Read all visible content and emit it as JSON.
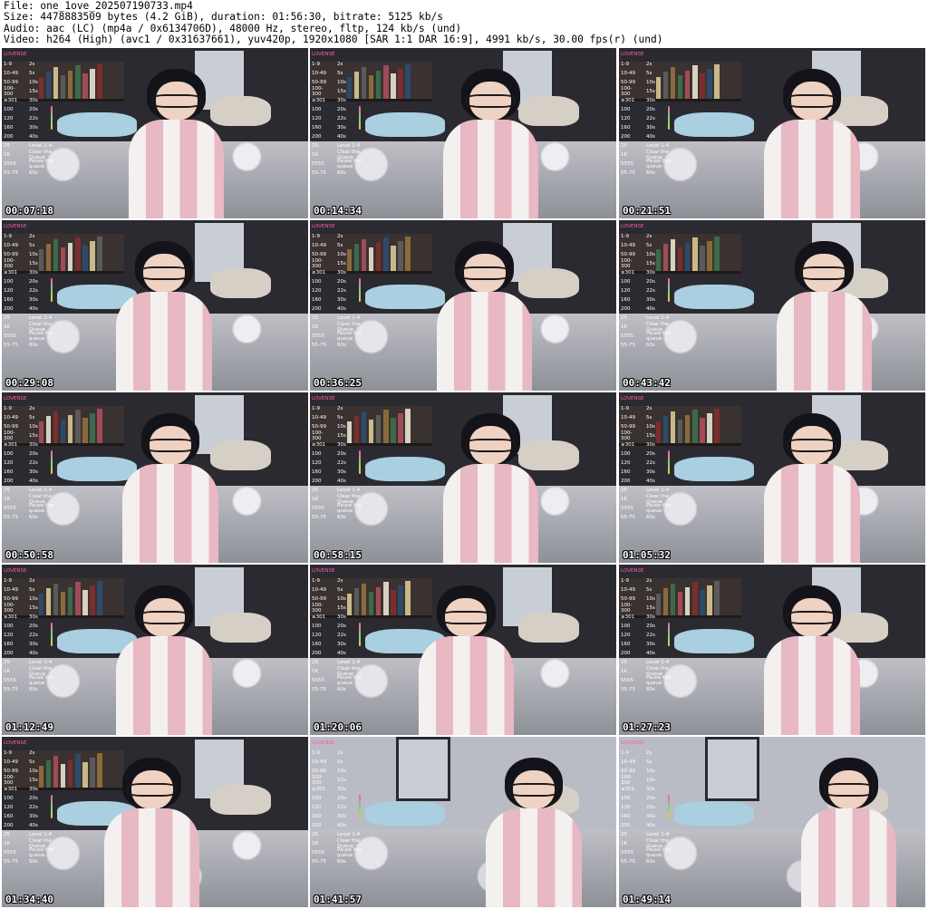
{
  "header": {
    "file": "File: one_1ove_202507190733.mp4",
    "size": "Size: 4478883509 bytes (4.2 GiB), duration: 01:56:30, bitrate: 5125 kb/s",
    "audio": "Audio: aac (LC) (mp4a / 0x6134706D), 48000 Hz, stereo, fltp, 124 kb/s (und)",
    "video": "Video: h264 (High) (avc1 / 0x31637661), yuv420p, 1920x1080 [SAR 1:1 DAR 16:9], 4991 kb/s, 30.00 fps(r) (und)"
  },
  "overlay": {
    "brand": "LOVENSE",
    "rows": [
      [
        "1-9",
        "2s"
      ],
      [
        "10-49",
        "5s"
      ],
      [
        "50-99",
        "10s"
      ],
      [
        "100-300",
        "15s"
      ],
      [
        "≥301",
        "30s"
      ],
      [
        "100",
        "20s"
      ],
      [
        "120",
        "22s"
      ],
      [
        "160",
        "30s"
      ],
      [
        "200",
        "40s"
      ],
      [
        "25",
        "Level 1-4"
      ],
      [
        "1K",
        "Clear the Queue"
      ],
      [
        "5555",
        "Pause the queue"
      ],
      [
        "55-75",
        "60s"
      ]
    ]
  },
  "thumbnails": [
    {
      "timestamp": "00:07:18"
    },
    {
      "timestamp": "00:14:34"
    },
    {
      "timestamp": "00:21:51"
    },
    {
      "timestamp": "00:29:08"
    },
    {
      "timestamp": "00:36:25"
    },
    {
      "timestamp": "00:43:42"
    },
    {
      "timestamp": "00:50:58"
    },
    {
      "timestamp": "00:58:15"
    },
    {
      "timestamp": "01:05:32"
    },
    {
      "timestamp": "01:12:49"
    },
    {
      "timestamp": "01:20:06"
    },
    {
      "timestamp": "01:27:23"
    },
    {
      "timestamp": "01:34:40"
    },
    {
      "timestamp": "01:41:57"
    },
    {
      "timestamp": "01:49:14"
    }
  ],
  "colors": {
    "wall": "#2b2a30",
    "cardigan_pink": "#e8b8c3",
    "cardigan_white": "#f3f0ef",
    "pillow_blue": "#a9cfe0",
    "overlay_accent": "#ff5ba7"
  }
}
